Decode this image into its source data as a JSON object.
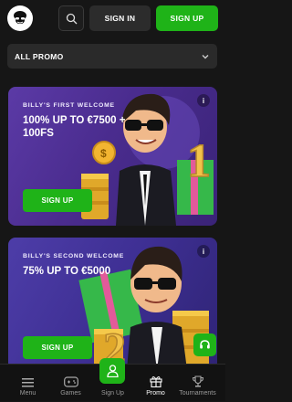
{
  "header": {
    "logo_icon": "billy-mascot-logo-icon",
    "search_icon": "search-icon",
    "sign_in_label": "SIGN IN",
    "sign_up_label": "SIGN UP"
  },
  "filter": {
    "selected": "ALL PROMO",
    "icon": "chevron-down-icon"
  },
  "promos": [
    {
      "eyebrow": "BILLY'S FIRST WELCOME",
      "title": "100% UP TO €7500 + 100FS",
      "cta": "SIGN UP",
      "info": "i",
      "art_number": "1"
    },
    {
      "eyebrow": "BILLY'S SECOND WELCOME",
      "title": "75% UP TO €5000",
      "cta": "SIGN UP",
      "info": "i",
      "art_number": "2"
    }
  ],
  "support_icon": "headset-icon",
  "bottom_nav": [
    {
      "label": "Menu",
      "icon": "hamburger-icon"
    },
    {
      "label": "Games",
      "icon": "gamepad-icon"
    },
    {
      "label": "Sign Up",
      "icon": "user-icon"
    },
    {
      "label": "Promo",
      "icon": "gift-icon"
    },
    {
      "label": "Tournaments",
      "icon": "trophy-icon"
    }
  ],
  "colors": {
    "accent_green": "#1fb318",
    "background": "#161616",
    "card_purple": "#4a2c8e"
  }
}
